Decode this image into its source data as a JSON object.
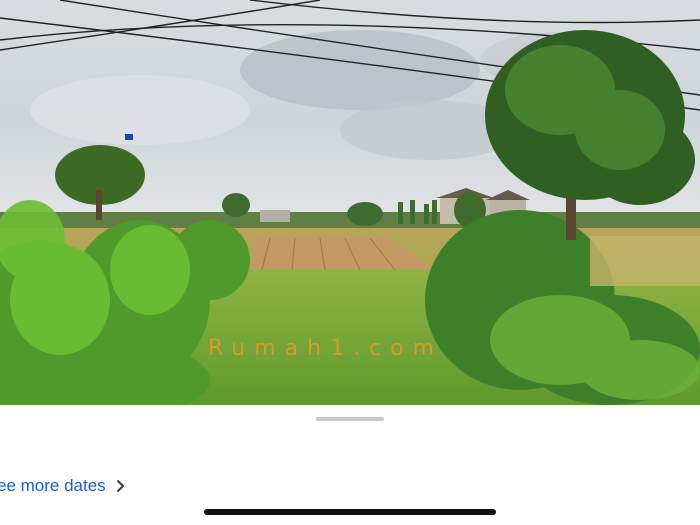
{
  "photo": {
    "description_icon": "street-view-photo",
    "watermark": "Rumah1.com"
  },
  "sheet": {
    "see_more_dates_label": "ee more dates",
    "chevron_icon": "chevron-right-icon"
  },
  "colors": {
    "link": "#1a5fd1",
    "watermark": "#e89a2a",
    "grabber": "#c7c7cc",
    "home_indicator": "#111111"
  }
}
